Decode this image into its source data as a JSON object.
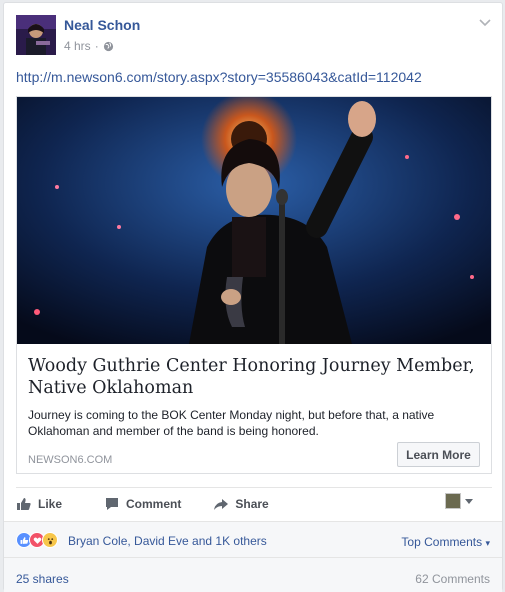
{
  "post": {
    "author": "Neal Schon",
    "time": "4 hrs",
    "dot": "·",
    "link": "http://m.newson6.com/story.aspx?story=35586043&catId=112042"
  },
  "attachment": {
    "title": "Woody Guthrie Center Honoring Journey Member, Native Oklahoman",
    "description": "Journey is coming to the BOK Center Monday night, but before that, a native Oklahoman and member of the band is being honored.",
    "domain": "NEWSON6.COM",
    "cta": "Learn More"
  },
  "actions": {
    "like": "Like",
    "comment": "Comment",
    "share": "Share"
  },
  "reactions": {
    "names": "Bryan Cole, David Eve and 1K others",
    "top_comments": "Top Comments",
    "top_comments_arrow": "▾"
  },
  "footer": {
    "shares": "25 shares",
    "comments": "62 Comments"
  },
  "colors": {
    "link": "#365899",
    "like_blue": "#5890ff",
    "love_red": "#f25268",
    "wow_yellow": "#f7c64a"
  }
}
